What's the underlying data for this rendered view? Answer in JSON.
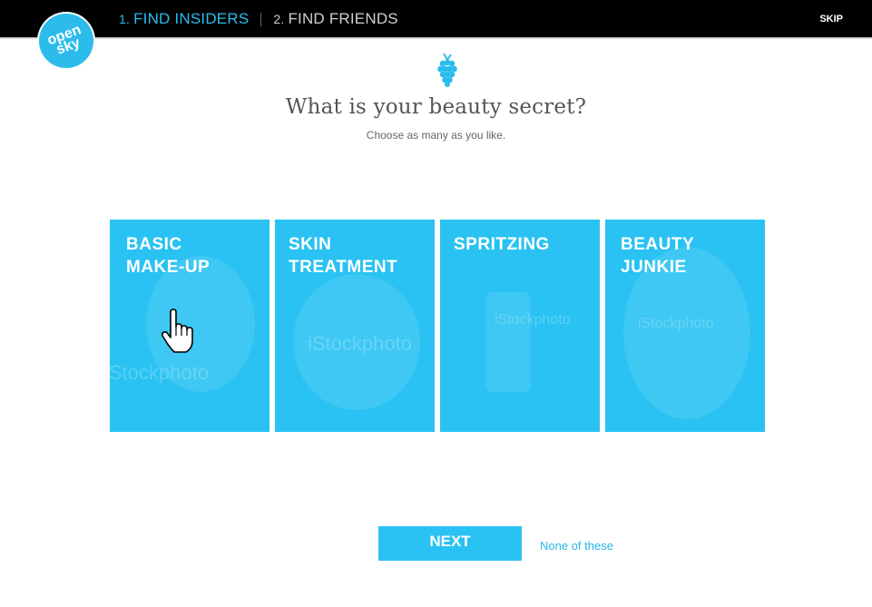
{
  "header": {
    "step1_num": "1.",
    "step1_label": "FIND INSIDERS",
    "step2_num": "2.",
    "step2_label": "FIND FRIENDS",
    "skip_label": "SKIP"
  },
  "logo": {
    "line1": "open",
    "line2": "sky"
  },
  "main": {
    "icon": "grape-icon",
    "heading": "What is your beauty secret?",
    "subheading": "Choose as many as you like."
  },
  "tiles": [
    {
      "label": "BASIC\nMAKE-UP"
    },
    {
      "label": "SKIN\nTREATMENT"
    },
    {
      "label": "SPRITZING"
    },
    {
      "label": "BEAUTY\nJUNKIE"
    }
  ],
  "actions": {
    "next_label": "NEXT",
    "none_label": "None of these"
  },
  "colors": {
    "accent": "#29c2f2",
    "topbar": "#000000",
    "heading": "#555555"
  }
}
